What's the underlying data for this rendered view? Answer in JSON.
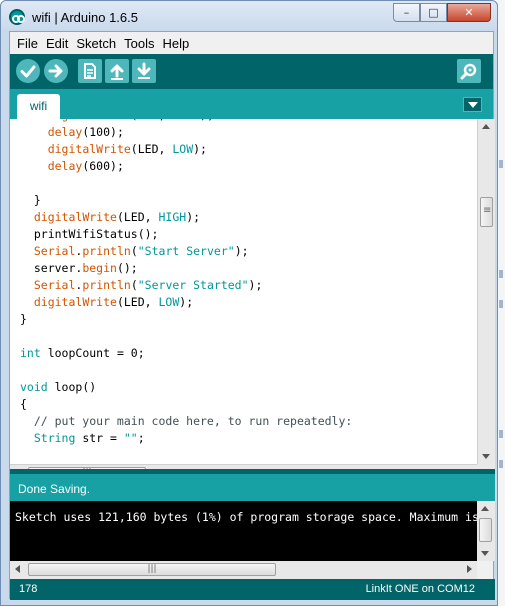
{
  "window": {
    "title": "wifi | Arduino 1.6.5",
    "minimize_glyph": "–",
    "maximize_glyph": "□",
    "close_glyph": "✕"
  },
  "menu": [
    "File",
    "Edit",
    "Sketch",
    "Tools",
    "Help"
  ],
  "toolbar": {
    "buttons": [
      {
        "name": "verify",
        "icon": "check-icon"
      },
      {
        "name": "upload",
        "icon": "arrow-right-icon"
      },
      {
        "name": "new",
        "icon": "new-file-icon"
      },
      {
        "name": "open",
        "icon": "arrow-up-icon"
      },
      {
        "name": "save",
        "icon": "arrow-down-icon"
      },
      {
        "name": "serial-monitor",
        "icon": "magnifier-icon"
      }
    ]
  },
  "tabs": [
    {
      "label": "wifi"
    }
  ],
  "editor": {
    "lines": [
      [
        {
          "t": "    "
        },
        {
          "t": "digitalWrite",
          "c": "fn"
        },
        {
          "t": "(LED, "
        },
        {
          "t": "HIGH",
          "c": "kw"
        },
        {
          "t": ");"
        }
      ],
      [
        {
          "t": "    "
        },
        {
          "t": "delay",
          "c": "fn"
        },
        {
          "t": "(100);"
        }
      ],
      [
        {
          "t": "    "
        },
        {
          "t": "digitalWrite",
          "c": "fn"
        },
        {
          "t": "(LED, "
        },
        {
          "t": "LOW",
          "c": "kw"
        },
        {
          "t": ");"
        }
      ],
      [
        {
          "t": "    "
        },
        {
          "t": "delay",
          "c": "fn"
        },
        {
          "t": "(600);"
        }
      ],
      [
        {
          "t": ""
        }
      ],
      [
        {
          "t": "  }"
        }
      ],
      [
        {
          "t": "  "
        },
        {
          "t": "digitalWrite",
          "c": "fn"
        },
        {
          "t": "(LED, "
        },
        {
          "t": "HIGH",
          "c": "kw"
        },
        {
          "t": ");"
        }
      ],
      [
        {
          "t": "  printWifiStatus();"
        }
      ],
      [
        {
          "t": "  "
        },
        {
          "t": "Serial",
          "c": "fn"
        },
        {
          "t": "."
        },
        {
          "t": "println",
          "c": "fn"
        },
        {
          "t": "("
        },
        {
          "t": "\"Start Server\"",
          "c": "kw"
        },
        {
          "t": ");"
        }
      ],
      [
        {
          "t": "  server."
        },
        {
          "t": "begin",
          "c": "fn"
        },
        {
          "t": "();"
        }
      ],
      [
        {
          "t": "  "
        },
        {
          "t": "Serial",
          "c": "fn"
        },
        {
          "t": "."
        },
        {
          "t": "println",
          "c": "fn"
        },
        {
          "t": "("
        },
        {
          "t": "\"Server Started\"",
          "c": "kw"
        },
        {
          "t": ");"
        }
      ],
      [
        {
          "t": "  "
        },
        {
          "t": "digitalWrite",
          "c": "fn"
        },
        {
          "t": "(LED, "
        },
        {
          "t": "LOW",
          "c": "kw"
        },
        {
          "t": ");"
        }
      ],
      [
        {
          "t": "}"
        }
      ],
      [
        {
          "t": ""
        }
      ],
      [
        {
          "t": "int",
          "c": "kw"
        },
        {
          "t": " loopCount = 0;"
        }
      ],
      [
        {
          "t": ""
        }
      ],
      [
        {
          "t": "void",
          "c": "kw"
        },
        {
          "t": " loop()"
        }
      ],
      [
        {
          "t": "{"
        }
      ],
      [
        {
          "t": "  // put your main code here, to run repeatedly:",
          "c": "cm"
        }
      ],
      [
        {
          "t": "  "
        },
        {
          "t": "String",
          "c": "kw"
        },
        {
          "t": " str = "
        },
        {
          "t": "\"\"",
          "c": "kw"
        },
        {
          "t": ";"
        }
      ]
    ]
  },
  "status": {
    "message": "Done Saving."
  },
  "console": {
    "text": "Sketch uses 121,160 bytes (1%) of program storage space. Maximum is"
  },
  "footer": {
    "line_number": "178",
    "board": "LinkIt ONE on COM12"
  },
  "colors": {
    "teal_dark": "#006468",
    "teal": "#17a1a5",
    "teal_light": "#4db7bb",
    "function": "#d35400",
    "keyword": "#00979c"
  }
}
